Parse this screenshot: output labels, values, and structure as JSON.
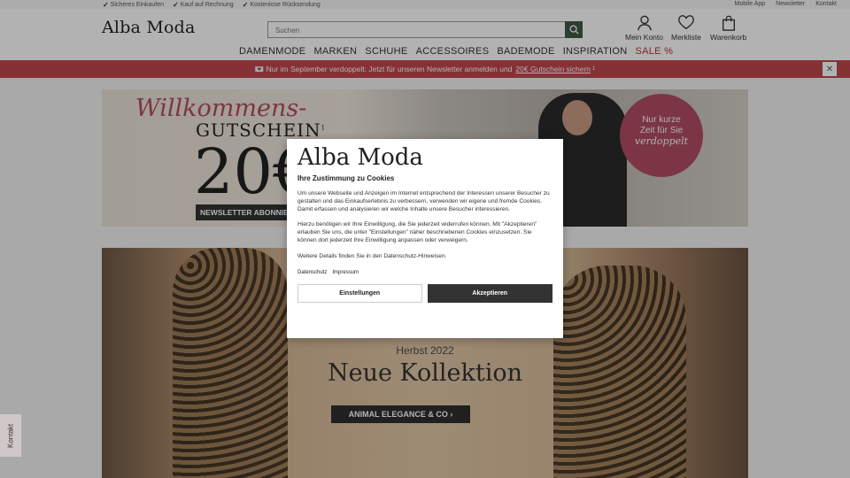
{
  "topbar": {
    "usps": [
      "Sicheres Einkaufen",
      "Kauf auf Rechnung",
      "Kostenlose Rücksendung"
    ],
    "links": [
      "Mobile App",
      "Newsletter",
      "Kontakt"
    ]
  },
  "header": {
    "logo": "Alba Moda",
    "search_placeholder": "Suchen",
    "account": [
      "Mein Konto",
      "Merkliste",
      "Warenkorb"
    ]
  },
  "nav": [
    "DAMENMODE",
    "MARKEN",
    "SCHUHE",
    "ACCESSOIRES",
    "BADEMODE",
    "INSPIRATION",
    "SALE %"
  ],
  "promo": {
    "text": "💌 Nur im September verdoppelt: Jetzt für unseren Newsletter anmelden und",
    "link": "20€ Gutschein sichern",
    "sup": "1",
    "close": "✕"
  },
  "hero1": {
    "script": "Willkommens-",
    "word": "GUTSCHEIN",
    "sup": "1",
    "amount": "20€",
    "button": "NEWSLETTER ABONNIEREN",
    "badge_line1": "Nur kurze",
    "badge_line2": "Zeit für Sie",
    "badge_line3": "verdoppelt"
  },
  "hero2": {
    "season": "Herbst 2022",
    "title": "Neue Kollektion",
    "cta": "ANIMAL ELEGANCE & CO ›"
  },
  "side": {
    "kontakt": "Kontakt"
  },
  "modal": {
    "logo": "Alba Moda",
    "heading": "Ihre Zustimmung zu Cookies",
    "p1": "Um unsere Webseite und Anzeigen im Internet entsprechend der Interessen unserer Besucher zu gestalten und das Einkaufserlebnis zu verbessern, verwenden wir eigene und fremde Cookies. Damit erfassen und analysieren wir welche Inhalte unsere Besucher interessieren.",
    "p2": "Hierzu benötigen wir Ihre Einwilligung, die Sie jederzeit widerrufen können. Mit \"Akzeptieren\" erlauben Sie uns, die unter \"Einstellungen\" näher beschriebenen Cookies einzusetzen. Sie können dort jederzeit Ihre Einwilligung anpassen oder verweigern.",
    "p3": "Weitere Details finden Sie in den Datenschutz-Hinweisen.",
    "link_privacy": "Datenschutz",
    "link_imprint": "Impressum",
    "btn_settings": "Einstellungen",
    "btn_accept": "Akzeptieren"
  }
}
